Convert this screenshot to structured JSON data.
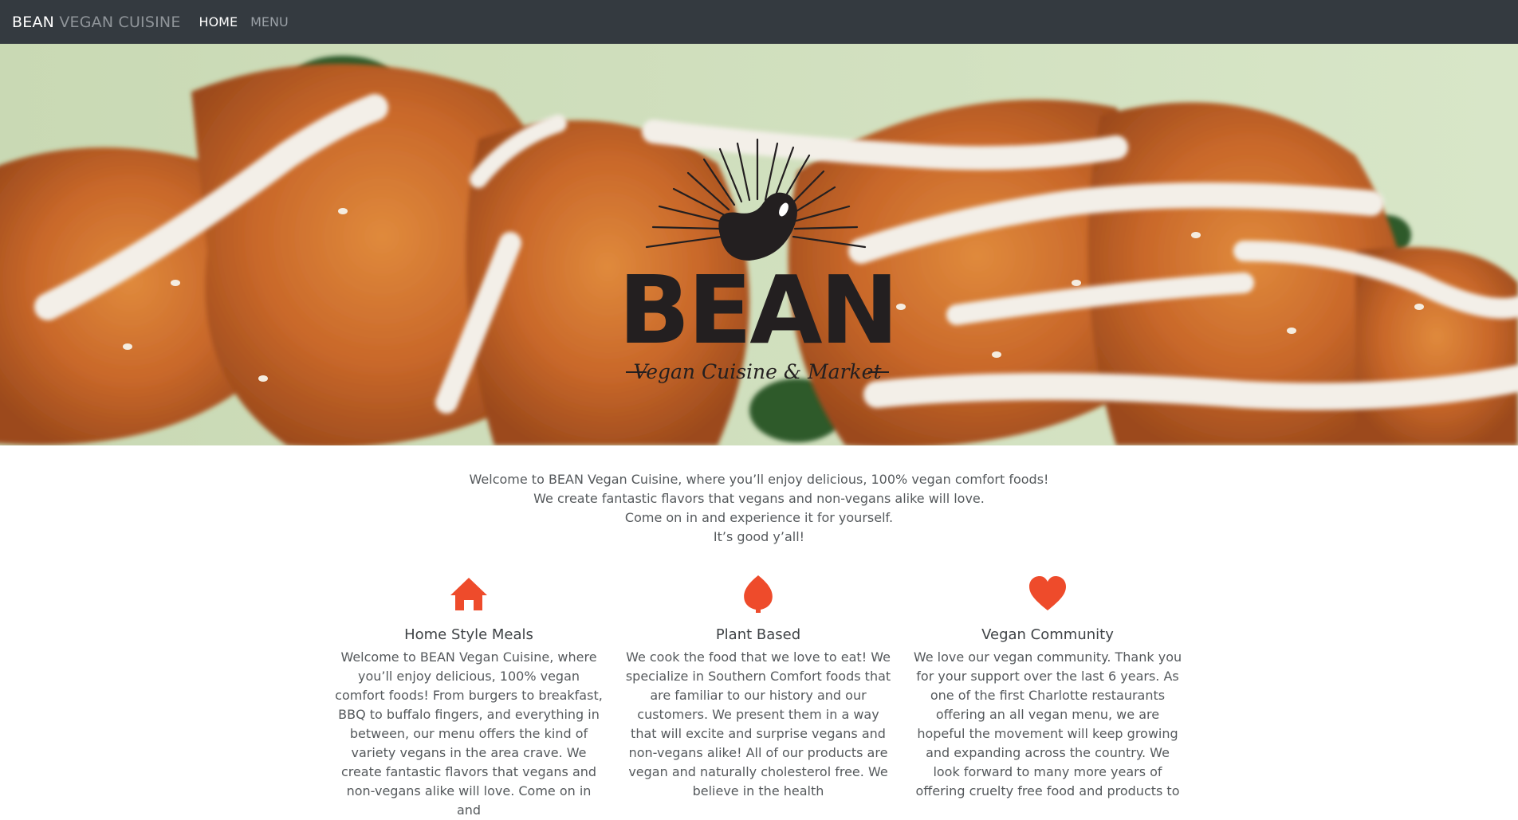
{
  "nav": {
    "brand_main": "BEAN",
    "brand_sub": "VEGAN CUISINE",
    "links": [
      {
        "label": "HOME",
        "active": true
      },
      {
        "label": "MENU",
        "active": false
      }
    ]
  },
  "hero": {
    "logo_title": "BEAN",
    "logo_tagline": "Vegan Cuisine & Market"
  },
  "intro": {
    "lines": [
      "Welcome to BEAN Vegan Cuisine, where you’ll enjoy delicious, 100% vegan comfort foods!",
      "We create fantastic flavors that vegans and non-vegans alike will love.",
      "Come on in and experience it for yourself.",
      "It’s good y’all!"
    ]
  },
  "features": [
    {
      "icon": "home-icon",
      "title": "Home Style Meals",
      "text": "Welcome to BEAN Vegan Cuisine, where you’ll enjoy delicious, 100% vegan comfort foods! From burgers to breakfast, BBQ to buffalo fingers, and everything in between, our menu offers the kind of variety vegans in the area crave. We create fantastic flavors that vegans and non-vegans alike will love. Come on in and"
    },
    {
      "icon": "leaf-icon",
      "title": "Plant Based",
      "text": "We cook the food that we love to eat! We specialize in Southern Comfort foods that are familiar to our history and our customers. We present them in a way that will excite and surprise vegans and non-vegans alike! All of our products are vegan and naturally cholesterol free. We believe in the health"
    },
    {
      "icon": "heart-icon",
      "title": "Vegan Community",
      "text": "We love our vegan community. Thank you for your support over the last 6 years. As one of the first Charlotte restaurants offering an all vegan menu, we are hopeful the movement will keep growing and expanding across the country. We look forward to many more years of offering cruelty free food and products to"
    }
  ],
  "colors": {
    "navbar": "#343a40",
    "accent": "#ee4b2b",
    "text": "#55595c"
  }
}
